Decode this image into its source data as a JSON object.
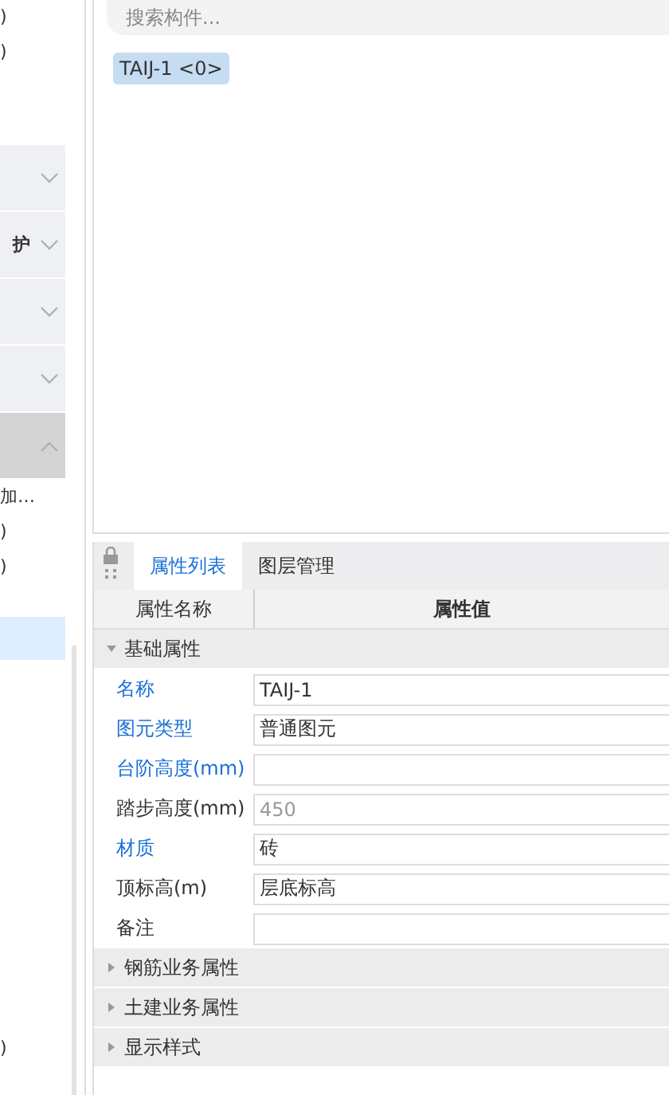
{
  "sidebar": {
    "items": [
      {
        "kind": "text",
        "label": ")",
        "selected": false
      },
      {
        "kind": "text",
        "label": ")",
        "selected": false
      },
      {
        "kind": "section",
        "expanded": false
      },
      {
        "kind": "section",
        "label": "护",
        "expanded": false
      },
      {
        "kind": "section",
        "expanded": false
      },
      {
        "kind": "section",
        "expanded": false
      },
      {
        "kind": "section",
        "expanded": true
      },
      {
        "kind": "text",
        "label": "加…",
        "selected": false
      },
      {
        "kind": "text",
        "label": ")",
        "selected": false
      },
      {
        "kind": "text",
        "label": ")",
        "selected": false
      },
      {
        "kind": "row",
        "selected": true
      },
      {
        "kind": "text",
        "label": ")",
        "selected": false
      }
    ]
  },
  "search": {
    "placeholder": "搜索构件..."
  },
  "components": [
    {
      "label": "TAIJ-1 <0>",
      "selected": true
    }
  ],
  "properties": {
    "tabs": [
      {
        "label": "属性列表",
        "selected": true
      },
      {
        "label": "图层管理",
        "selected": false
      }
    ],
    "columns": [
      "属性名称",
      "属性值"
    ],
    "groups": [
      {
        "label": "基础属性",
        "expanded": true,
        "rows": [
          {
            "name": "名称",
            "highlighted": true,
            "value": "TAIJ-1",
            "disabled": false
          },
          {
            "name": "图元类型",
            "highlighted": true,
            "value": "普通图元",
            "disabled": false
          },
          {
            "name": "台阶高度(mm)",
            "highlighted": true,
            "disabled": false
          },
          {
            "name": "踏步高度(mm)",
            "highlighted": false,
            "value": "450",
            "disabled": true
          },
          {
            "name": "材质",
            "highlighted": true,
            "value": "砖",
            "disabled": false
          },
          {
            "name": "顶标高(m)",
            "highlighted": false,
            "value": "层底标高",
            "disabled": false
          },
          {
            "name": "备注",
            "highlighted": false,
            "disabled": false
          }
        ]
      },
      {
        "label": "钢筋业务属性",
        "expanded": false
      },
      {
        "label": "土建业务属性",
        "expanded": false
      },
      {
        "label": "显示样式",
        "expanded": false
      }
    ]
  }
}
